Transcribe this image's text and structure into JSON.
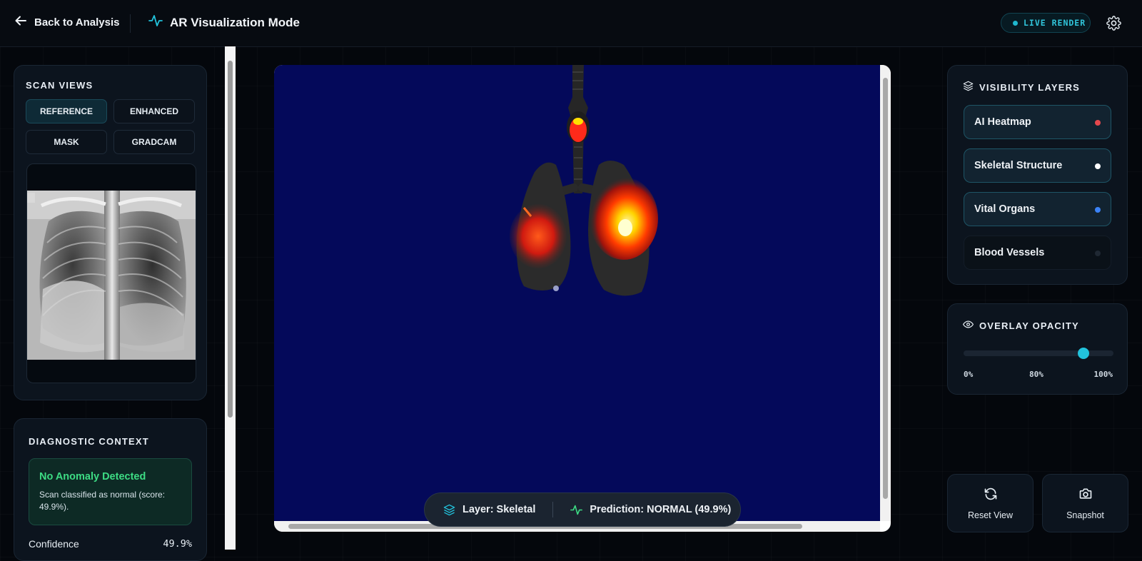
{
  "header": {
    "back_label": "Back to Analysis",
    "title": "AR Visualization Mode",
    "live_badge": "LIVE RENDER"
  },
  "scan_views": {
    "title": "SCAN VIEWS",
    "options": [
      "REFERENCE",
      "ENHANCED",
      "MASK",
      "GRADCAM"
    ],
    "selected": "REFERENCE"
  },
  "diagnostic": {
    "title": "DIAGNOSTIC CONTEXT",
    "status_heading": "No Anomaly Detected",
    "status_text": "Scan classified as normal (score: 49.9%).",
    "confidence_label": "Confidence",
    "confidence_value": "49.9%"
  },
  "status_pill": {
    "layer_text": "Layer: Skeletal",
    "prediction_text": "Prediction: NORMAL (49.9%)"
  },
  "visibility_layers": {
    "title": "VISIBILITY LAYERS",
    "items": [
      {
        "label": "AI Heatmap",
        "enabled": true,
        "color": "#e5484d"
      },
      {
        "label": "Skeletal Structure",
        "enabled": true,
        "color": "#ffffff"
      },
      {
        "label": "Vital Organs",
        "enabled": true,
        "color": "#3b82f6"
      },
      {
        "label": "Blood Vessels",
        "enabled": false,
        "color": "#1f2833"
      }
    ]
  },
  "opacity": {
    "title": "OVERLAY OPACITY",
    "min_label": "0%",
    "current_label": "80%",
    "max_label": "100%",
    "value_percent": 80
  },
  "actions": {
    "reset_label": "Reset View",
    "snapshot_label": "Snapshot"
  },
  "colors": {
    "accent": "#22c3dc",
    "viewport_bg": "#04095a",
    "success": "#3ddc84"
  }
}
